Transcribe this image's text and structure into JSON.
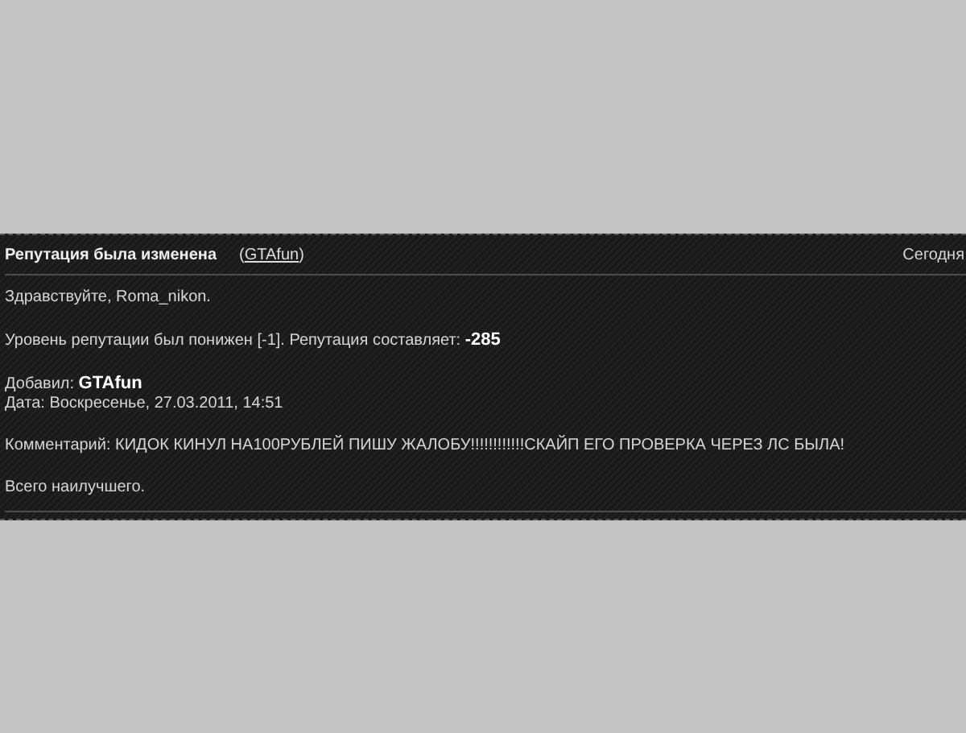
{
  "notification": {
    "title": "Репутация была изменена",
    "author_open": "(",
    "author_link": "GTAfun",
    "author_close": ")",
    "date": "Сегодня",
    "paragraphs": [
      [
        "Здравствуйте, Roma_nikon."
      ],
      [
        "Уровень репутации был понижен [-1]. Репутация составляет: **-285**"
      ],
      [
        "Добавил: **GTAfun**",
        "Дата: Воскресенье, 27.03.2011, 14:51"
      ],
      [
        "Комментарий: КИДОК КИНУЛ НА100РУБЛЕЙ ПИШУ ЖАЛОБУ!!!!!!!!!!!!СКАЙП ЕГО ПРОВЕРКА ЧЕРЕЗ ЛС БЫЛА!"
      ],
      [
        "Всего наилучшего."
      ]
    ]
  }
}
